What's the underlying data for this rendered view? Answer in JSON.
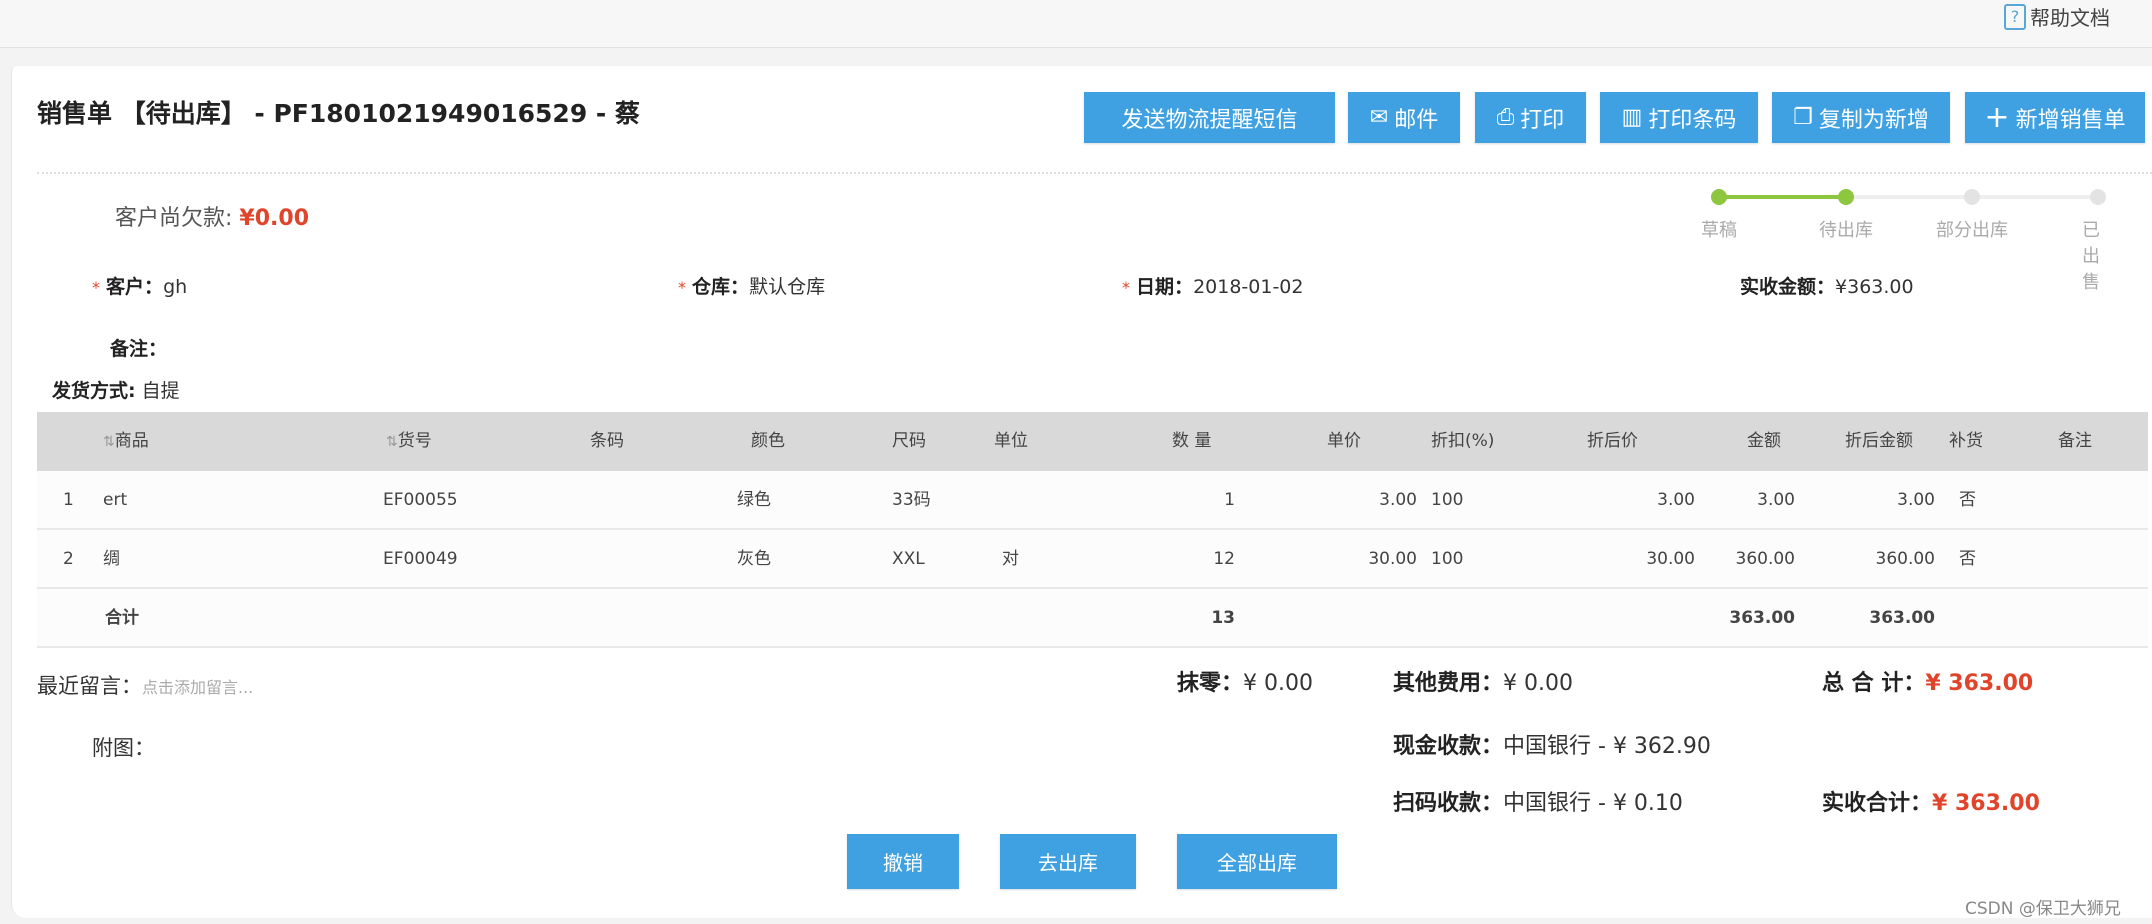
{
  "help": {
    "label": "帮助文档"
  },
  "title": "销售单 【待出库】 - PF1801021949016529 - 蔡",
  "toolbar": {
    "sms": "发送物流提醒短信",
    "mail": "邮件",
    "print": "打印",
    "barcode": "打印条码",
    "copy": "复制为新增",
    "new": "新增销售单"
  },
  "debt": {
    "label": "客户尚欠款:",
    "value": "¥0.00"
  },
  "steps": [
    {
      "label": "草稿",
      "done": true
    },
    {
      "label": "待出库",
      "done": true
    },
    {
      "label": "部分出库",
      "done": false
    },
    {
      "label": "已出售",
      "done": false
    }
  ],
  "colors": {
    "accent": "#3fa1e2",
    "done": "#8dc63f",
    "red": "#e0452b"
  },
  "fields": {
    "customer_label": "客户：",
    "customer": "gh",
    "warehouse_label": "仓库：",
    "warehouse": "默认仓库",
    "date_label": "日期：",
    "date": "2018-01-02",
    "received_label": "实收金额：",
    "received": "¥363.00",
    "remark_label": "备注：",
    "ship_label": "发货方式:",
    "ship": "自提"
  },
  "table": {
    "headers": [
      "商品",
      "货号",
      "条码",
      "颜色",
      "尺码",
      "单位",
      "数 量",
      "单价",
      "折扣(%)",
      "折后价",
      "金额",
      "折后金额",
      "补货",
      "备注"
    ],
    "rows": [
      [
        "1",
        "ert",
        "EF00055",
        "",
        "绿色",
        "33码",
        "",
        "1",
        "3.00",
        "100",
        "3.00",
        "3.00",
        "3.00",
        "否",
        ""
      ],
      [
        "2",
        "绸",
        "EF00049",
        "",
        "灰色",
        "XXL",
        "对",
        "12",
        "30.00",
        "100",
        "30.00",
        "360.00",
        "360.00",
        "否",
        ""
      ]
    ],
    "total": {
      "label": "合计",
      "qty": "13",
      "amount": "363.00",
      "disc_amount": "363.00"
    }
  },
  "bottom": {
    "msg_label": "最近留言：",
    "msg_placeholder": "点击添加留言...",
    "attach_label": "附图：",
    "round_label": "抹零：",
    "round": "¥ 0.00",
    "other_label": "其他费用：",
    "other": "¥ 0.00",
    "total_label": "总 合 计：",
    "total": "¥ 363.00",
    "cash_label": "现金收款：",
    "cash": "中国银行 - ¥ 362.90",
    "scan_label": "扫码收款：",
    "scan": "中国银行 - ¥ 0.10",
    "actual_label": "实收合计：",
    "actual": "¥ 363.00"
  },
  "actions": {
    "revoke": "撤销",
    "outbound": "去出库",
    "all_out": "全部出库"
  },
  "watermark": "CSDN @保卫大狮兄"
}
